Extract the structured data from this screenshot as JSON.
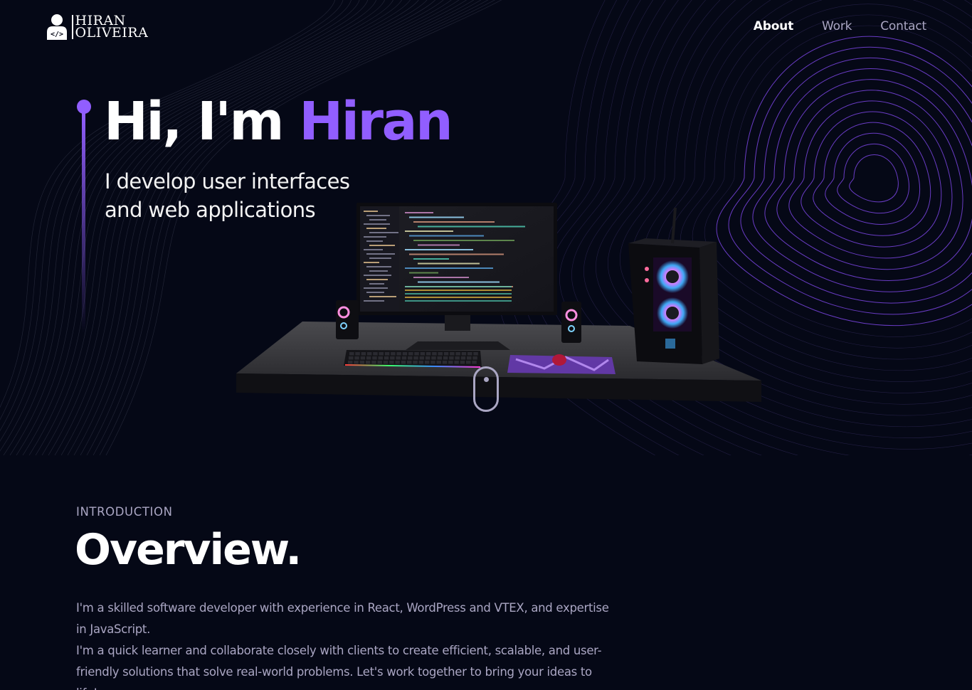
{
  "brand": {
    "line1": "HIRAN",
    "line2": "OLIVEIRA",
    "logo_icon": "user-code-icon"
  },
  "nav": {
    "items": [
      {
        "label": "About",
        "active": true
      },
      {
        "label": "Work",
        "active": false
      },
      {
        "label": "Contact",
        "active": false
      }
    ]
  },
  "hero": {
    "greeting": "Hi, I'm ",
    "name": "Hiran",
    "subtitle_line1": "I develop user interfaces",
    "subtitle_line2": "and web applications",
    "scroll_icon": "mouse-scroll-icon"
  },
  "overview": {
    "subtitle": "Introduction",
    "title": "Overview.",
    "paragraph1": "I'm a skilled software developer with experience in React, WordPress and VTEX, and expertise in JavaScript.",
    "paragraph2": "I'm a quick learner and collaborate closely with clients to create efficient, scalable, and user-friendly solutions that solve real-world problems. Let's work together to bring your ideas to life!"
  },
  "colors": {
    "background": "#050816",
    "accent": "#915eff",
    "secondary_text": "#aaa6c3",
    "white": "#ffffff"
  }
}
